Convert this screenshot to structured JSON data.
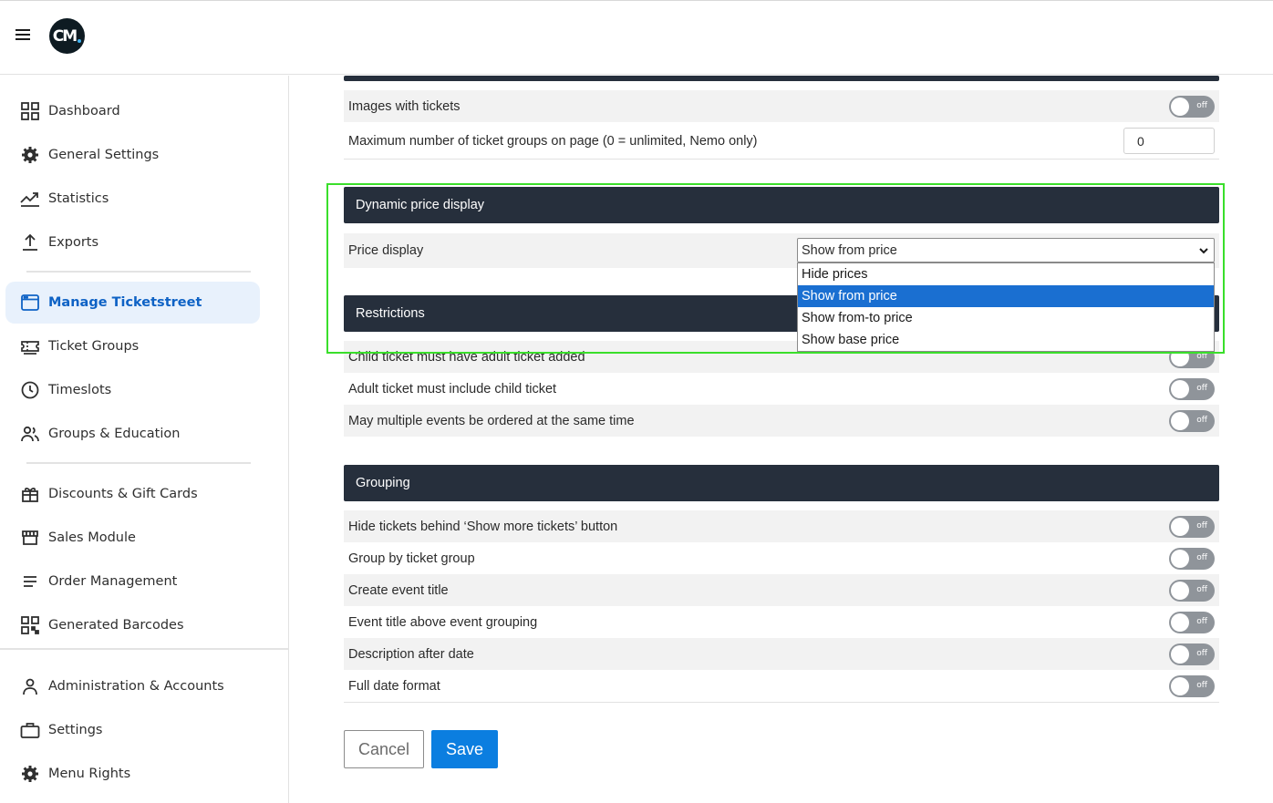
{
  "sidebar": {
    "items": [
      {
        "label": "Dashboard",
        "icon": "dashboard-icon"
      },
      {
        "label": "General Settings",
        "icon": "gear-icon"
      },
      {
        "label": "Statistics",
        "icon": "chart-line-icon"
      },
      {
        "label": "Exports",
        "icon": "export-icon"
      },
      {
        "label": "Manage Ticketstreet",
        "icon": "browser-window-icon"
      },
      {
        "label": "Ticket Groups",
        "icon": "ticket-icon"
      },
      {
        "label": "Timeslots",
        "icon": "clock-icon"
      },
      {
        "label": "Groups & Education",
        "icon": "people-icon"
      },
      {
        "label": "Discounts & Gift Cards",
        "icon": "gift-icon"
      },
      {
        "label": "Sales Module",
        "icon": "store-icon"
      },
      {
        "label": "Order Management",
        "icon": "list-icon"
      },
      {
        "label": "Generated Barcodes",
        "icon": "qr-code-icon"
      },
      {
        "label": "Administration & Accounts",
        "icon": "user-icon"
      },
      {
        "label": "Settings",
        "icon": "briefcase-icon"
      },
      {
        "label": "Menu Rights",
        "icon": "gear-icon"
      }
    ],
    "active": "Manage Ticketstreet"
  },
  "header": {
    "logo_text": "CM"
  },
  "main": {
    "top_rows": [
      {
        "label": "Images with tickets",
        "toggle": "off"
      },
      {
        "label": "Maximum number of ticket groups on page (0 = unlimited, Nemo only)",
        "value": "0"
      }
    ],
    "dynamic_price": {
      "title": "Dynamic price display",
      "price_label": "Price display",
      "selected": "Show from price",
      "options": [
        "Hide prices",
        "Show from price",
        "Show from-to price",
        "Show base price"
      ]
    },
    "restrictions": {
      "title": "Restrictions",
      "rows": [
        {
          "label": "Child ticket must have adult ticket added",
          "toggle": "off"
        },
        {
          "label": "Adult ticket must include child ticket",
          "toggle": "off"
        },
        {
          "label": "May multiple events be ordered at the same time",
          "toggle": "off"
        }
      ]
    },
    "grouping": {
      "title": "Grouping",
      "rows": [
        {
          "label": "Hide tickets behind ‘Show more tickets’ button",
          "toggle": "off"
        },
        {
          "label": "Group by ticket group",
          "toggle": "off"
        },
        {
          "label": "Create event title",
          "toggle": "off"
        },
        {
          "label": "Event title above event grouping",
          "toggle": "off"
        },
        {
          "label": "Description after date",
          "toggle": "off"
        },
        {
          "label": "Full date format",
          "toggle": "off"
        }
      ]
    },
    "buttons": {
      "cancel": "Cancel",
      "save": "Save"
    }
  },
  "colors": {
    "accent": "#0b7ee0",
    "header_bg": "#262f3c",
    "active_nav": "#0e62c5",
    "highlight": "#3adf2b"
  }
}
